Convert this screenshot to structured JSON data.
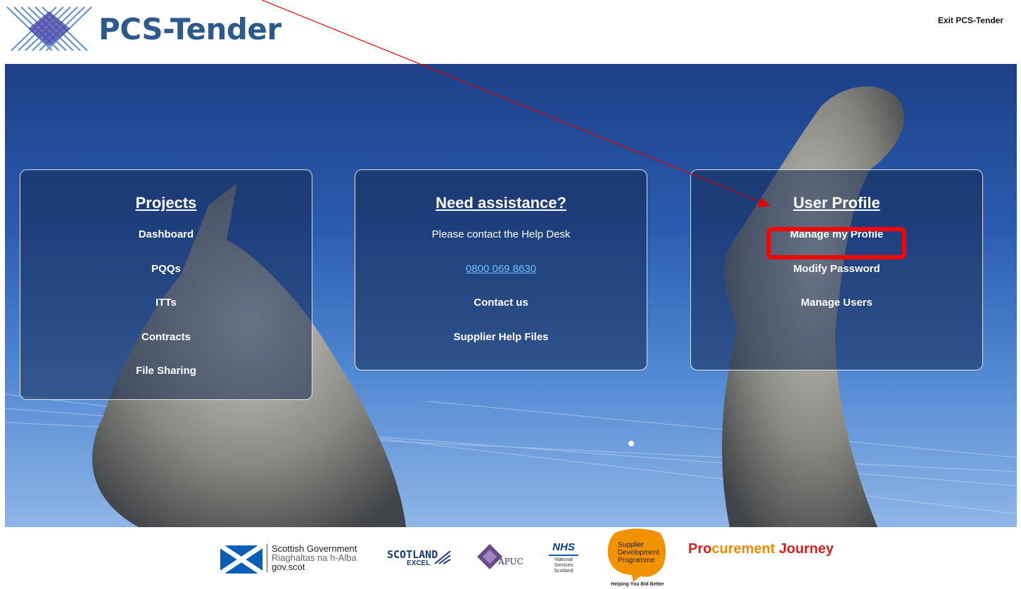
{
  "header": {
    "logo_text": "PCS-Tender",
    "exit_label": "Exit PCS-Tender"
  },
  "panels": {
    "projects": {
      "title": "Projects",
      "items": [
        "Dashboard",
        "PQQs",
        "ITTs",
        "Contracts",
        "File Sharing"
      ]
    },
    "help": {
      "title": "Need assistance?",
      "contact_text": "Please contact the Help Desk",
      "phone": "0800 069 8630",
      "contact_us": "Contact us",
      "help_files": "Supplier Help Files"
    },
    "profile": {
      "title": "User Profile",
      "items": [
        "Manage my Profile",
        "Modify Password",
        "Manage Users"
      ]
    }
  },
  "footer": {
    "scotgov_line1": "Scottish Government",
    "scotgov_line2": "Riaghaltas na h-Alba",
    "scotgov_line3": "gov.scot",
    "scotland_excel": "SCOTLAND",
    "scotland_excel_sub": "EXCEL",
    "apuc": "APUC",
    "nhs": "NHS",
    "nhs_sub1": "National",
    "nhs_sub2": "Services",
    "nhs_sub3": "Scotland",
    "sdp_line1": "Supplier",
    "sdp_line2": "Development",
    "sdp_line3": "Programme",
    "sdp_tagline": "Helping You Bid Better",
    "pj_part1": "Pro",
    "pj_part2": "curement ",
    "pj_part3": "Journey"
  },
  "colors": {
    "logo_blue": "#2c5a8c",
    "highlight_red": "#ff0000",
    "phone_link": "#6ec0ff",
    "sdp_orange": "#f39200"
  }
}
